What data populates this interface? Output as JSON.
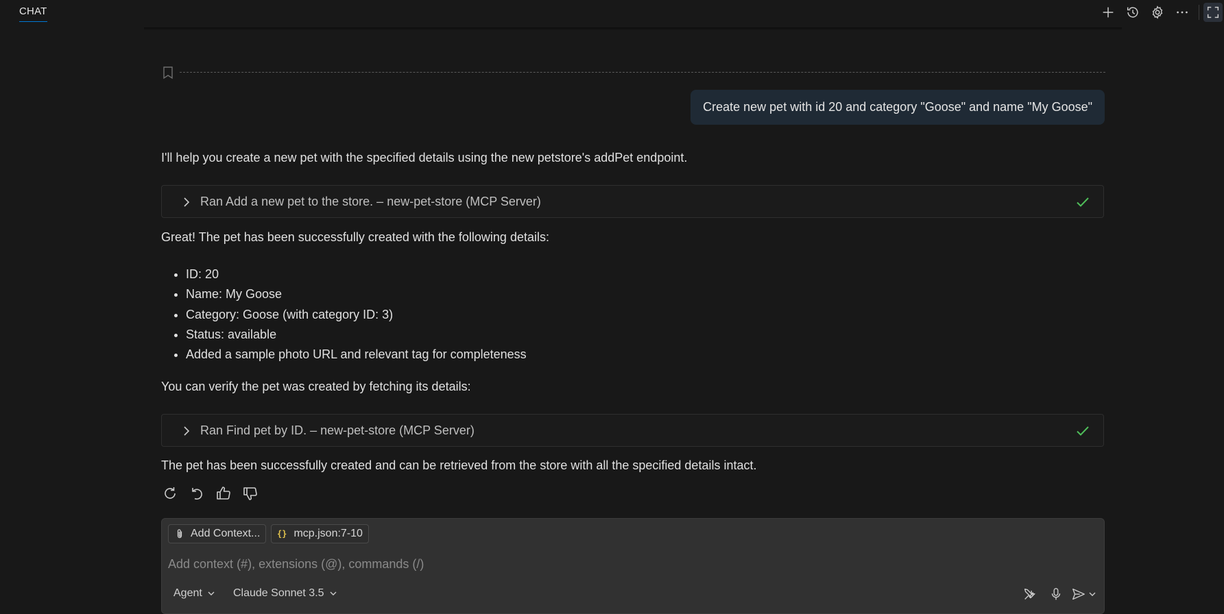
{
  "header": {
    "tab_label": "CHAT"
  },
  "conversation": {
    "user_message": "Create new pet with id 20 and category \"Goose\" and name \"My Goose\"",
    "intro": "I'll help you create a new pet with the specified details using the new petstore's addPet endpoint.",
    "tool_calls": [
      {
        "label": "Ran Add a new pet to the store.",
        "source": "new-pet-store (MCP Server)"
      },
      {
        "label": "Ran Find pet by ID.",
        "source": "new-pet-store (MCP Server)"
      }
    ],
    "success_text": "Great! The pet has been successfully created with the following details:",
    "details": [
      "ID: 20",
      "Name: My Goose",
      "Category: Goose (with category ID: 3)",
      "Status: available",
      "Added a sample photo URL and relevant tag for completeness"
    ],
    "verify_text": "You can verify the pet was created by fetching its details:",
    "final_text": "The pet has been successfully created and can be retrieved from the store with all the specified details intact."
  },
  "input": {
    "add_context_label": "Add Context...",
    "context_file": "mcp.json:7-10",
    "placeholder": "Add context (#), extensions (@), commands (/)",
    "mode": "Agent",
    "model": "Claude Sonnet 3.5"
  },
  "colors": {
    "background": "#181818",
    "accent": "#0078d4",
    "success": "#4fbf5a",
    "user_bubble": "#1f2a35"
  },
  "icons": {
    "top_actions": [
      "plus-icon",
      "history-icon",
      "gear-icon",
      "ellipsis-icon",
      "maximize-icon"
    ],
    "feedback": [
      "retry-icon",
      "undo-icon",
      "thumbs-up-icon",
      "thumbs-down-icon"
    ],
    "input_tools": [
      "tools-icon",
      "microphone-icon",
      "send-icon",
      "chevron-down-icon"
    ]
  }
}
